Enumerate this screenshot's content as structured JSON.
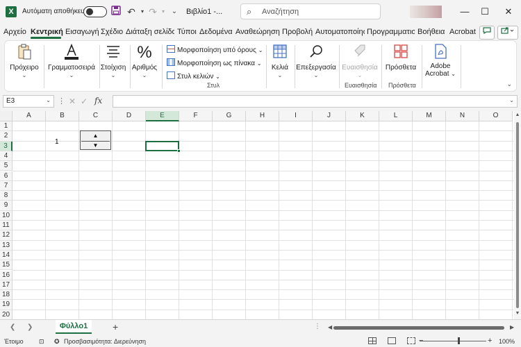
{
  "titlebar": {
    "app_icon": "excel-logo-icon",
    "app_letter": "X",
    "autosave_label": "Αυτόματη αποθήκευση",
    "autosave_state": "off",
    "save_icon": "save-icon",
    "undo_icon": "undo-icon",
    "redo_icon": "redo-icon",
    "doc_title": "Βιβλίο1 -...",
    "search_placeholder": "Αναζήτηση",
    "minimize": "—",
    "maximize": "☐",
    "close": "✕"
  },
  "tabs": [
    "Αρχείο",
    "Κεντρική",
    "Εισαγωγή",
    "Σχέδιο",
    "Διάταξη σελίδο",
    "Τύποι",
    "Δεδομένα",
    "Αναθεώρηση",
    "Προβολή",
    "Αυτοματοποίησ",
    "Προγραμματιστ",
    "Βοήθεια",
    "Acrobat"
  ],
  "active_tab": "Κεντρική",
  "ribbon": {
    "clipboard": "Πρόχειρο",
    "font": "Γραμματοσειρά",
    "alignment": "Στοίχιση",
    "number": "Αριθμός",
    "cond_format": "Μορφοποίηση υπό όρους",
    "format_table": "Μορφοποίηση ως πίνακα",
    "cell_styles": "Στυλ κελιών",
    "styles_group": "Στυλ",
    "cells": "Κελιά",
    "editing": "Επεξεργασία",
    "sensitivity": "Ευαισθησία",
    "sensitivity_group": "Ευαισθησία",
    "addins": "Πρόσθετα",
    "addins_group": "Πρόσθετα",
    "adobe_line1": "Adobe",
    "adobe_line2": "Acrobat",
    "number_symbol": "%"
  },
  "formula_bar": {
    "name_box": "E3",
    "fx": "fx",
    "formula": ""
  },
  "grid": {
    "columns": [
      "A",
      "B",
      "C",
      "D",
      "E",
      "F",
      "G",
      "H",
      "I",
      "J",
      "K",
      "L",
      "M",
      "N",
      "O"
    ],
    "rows": [
      "1",
      "2",
      "3",
      "4",
      "5",
      "6",
      "7",
      "8",
      "9",
      "10",
      "11",
      "12",
      "13",
      "14",
      "15",
      "16",
      "17",
      "18",
      "19",
      "20"
    ],
    "selected_cell": "E3",
    "cell_B2_value": "1",
    "spinner_up": "▲",
    "spinner_down": "▼"
  },
  "sheets": {
    "active": "Φύλλο1",
    "add": "+"
  },
  "status": {
    "ready": "Έτοιμο",
    "accessibility": "Προσβασιμότητα: Διερεύνηση",
    "zoom": "100%",
    "zoom_minus": "−",
    "zoom_plus": "+"
  }
}
